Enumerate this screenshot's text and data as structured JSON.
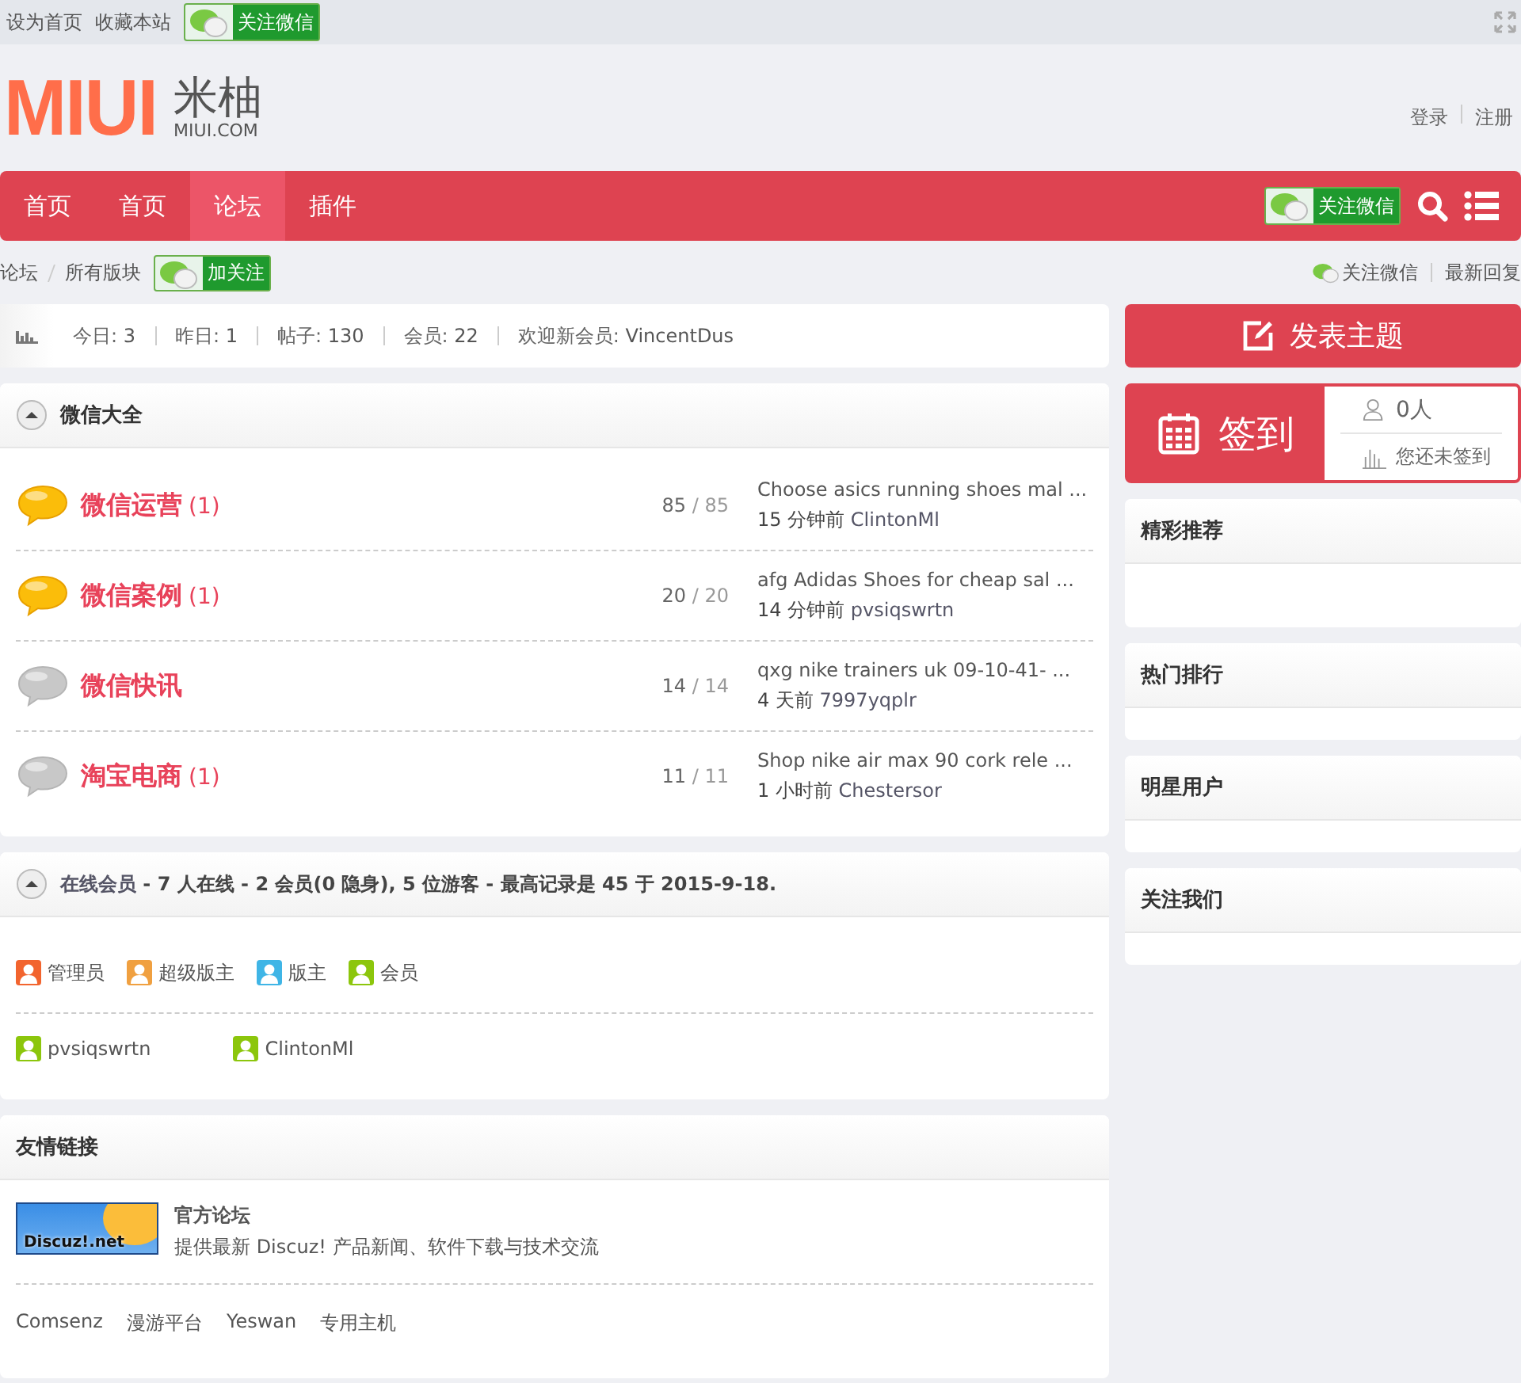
{
  "topbar": {
    "links": [
      "设为首页",
      "收藏本站"
    ],
    "wechat_badge": "关注微信"
  },
  "logo": {
    "mark": "MIUI",
    "name": "米柚",
    "domain": "MIUI.COM"
  },
  "account": [
    "登录",
    "注册"
  ],
  "nav": {
    "items": [
      {
        "label": "首页",
        "selected": false
      },
      {
        "label": "首页",
        "selected": false
      },
      {
        "label": "论坛",
        "selected": true
      },
      {
        "label": "插件",
        "selected": false
      }
    ],
    "wechat_badge": "关注微信"
  },
  "breadcrumb": {
    "items": [
      "论坛",
      "所有版块"
    ],
    "follow_badge": "加关注",
    "right_links": [
      "关注微信",
      "最新回复"
    ]
  },
  "stats": [
    {
      "label": "今日:",
      "value": "3"
    },
    {
      "label": "昨日:",
      "value": "1"
    },
    {
      "label": "帖子:",
      "value": "130"
    },
    {
      "label": "会员:",
      "value": "22"
    },
    {
      "label": "欢迎新会员:",
      "value": "VincentDus"
    }
  ],
  "forum_group": {
    "title": "微信大全",
    "forums": [
      {
        "name": "微信运营",
        "today": "(1)",
        "has_new": true,
        "threads": "85",
        "posts": "/ 85",
        "last_title": "Choose asics running shoes mal ...",
        "last_time": "15 分钟前",
        "last_user": "ClintonMl"
      },
      {
        "name": "微信案例",
        "today": "(1)",
        "has_new": true,
        "threads": "20",
        "posts": "/ 20",
        "last_title": "afg Adidas Shoes for cheap sal ...",
        "last_time": "14 分钟前",
        "last_user": "pvsiqswrtn"
      },
      {
        "name": "微信快讯",
        "has_new": false,
        "threads": "14",
        "posts": "/ 14",
        "last_title": "qxg nike trainers uk 09-10-41- ...",
        "last_time": "4 天前",
        "last_user": "7997yqplr"
      },
      {
        "name": "淘宝电商",
        "today": "(1)",
        "has_new": false,
        "threads": "11",
        "posts": "/ 11",
        "last_title": "Shop nike air max 90 cork rele ...",
        "last_time": "1 小时前",
        "last_user": "Chestersor"
      }
    ]
  },
  "online": {
    "title_link": "在线会员",
    "summary": " - 7 人在线 - 2 会员(0 隐身), 5 位游客 - 最高记录是 45 于 2015-9-18.",
    "legend": [
      {
        "label": "管理员",
        "color": "#f2642e"
      },
      {
        "label": "超级版主",
        "color": "#f0a040"
      },
      {
        "label": "版主",
        "color": "#3fb5e6"
      },
      {
        "label": "会员",
        "color": "#8cc60c"
      }
    ],
    "users": [
      {
        "name": "pvsiqswrtn",
        "color": "#8cc60c"
      },
      {
        "name": "ClintonMl",
        "color": "#8cc60c"
      }
    ]
  },
  "friend_links": {
    "title": "友情链接",
    "featured": {
      "logo": "Discuz!.net",
      "name": "官方论坛",
      "desc": "提供最新 Discuz! 产品新闻、软件下载与技术交流"
    },
    "links": [
      "Comsenz",
      "漫游平台",
      "Yeswan",
      "专用主机"
    ]
  },
  "sidebar": {
    "post_button": "发表主题",
    "checkin": {
      "label": "签到",
      "count": "0人",
      "status": "您还未签到"
    },
    "panels": [
      "精彩推荐",
      "热门排行",
      "明星用户",
      "关注我们"
    ]
  }
}
